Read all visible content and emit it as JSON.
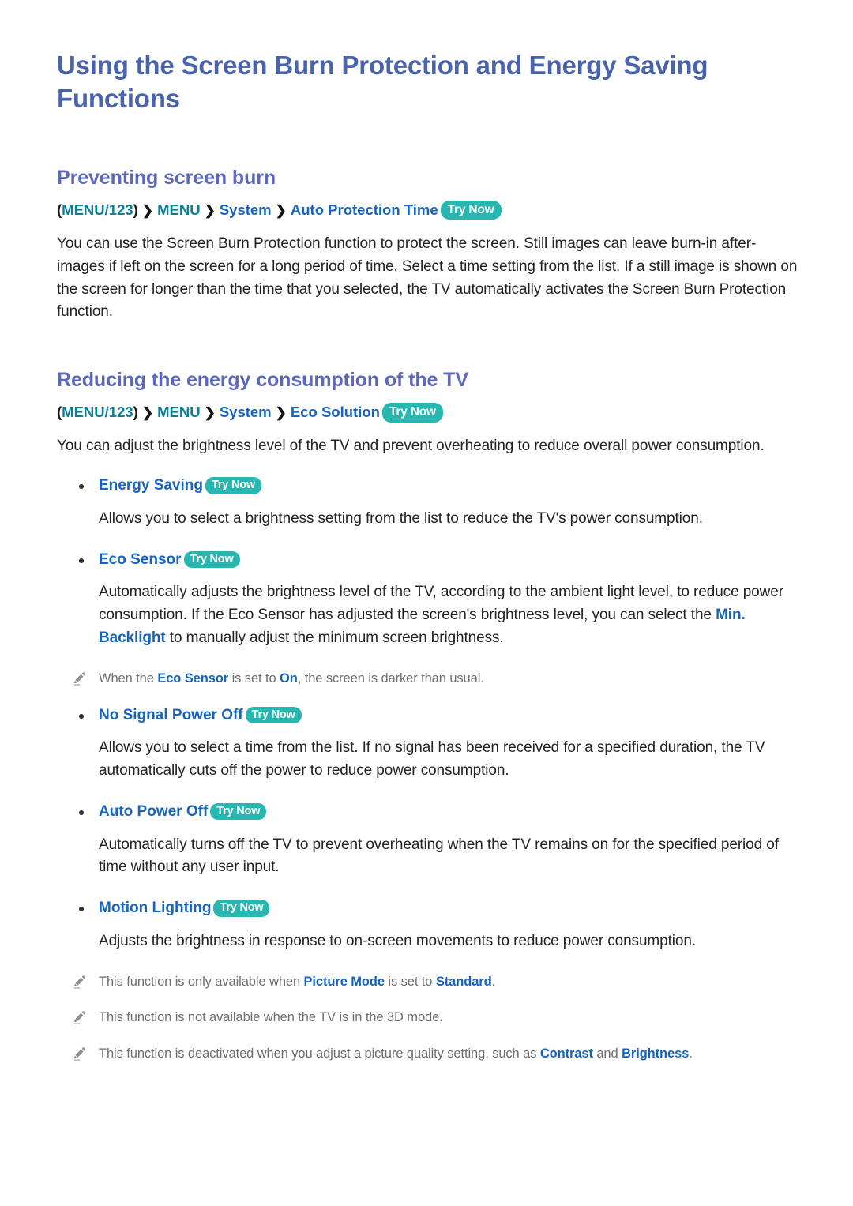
{
  "document": {
    "title": "Using the Screen Burn Protection and Energy Saving Functions"
  },
  "colors": {
    "title_blue": "#4a63ad",
    "heading_blue": "#5b68bc",
    "link_blue": "#1565c0",
    "breadcrumb_teal": "#0c7e96",
    "badge_teal": "#26b7b0",
    "body_text": "#232323",
    "note_text": "#6e6e6e"
  },
  "labels": {
    "try_now": "Try Now",
    "separator": "❯"
  },
  "sections": [
    {
      "heading": "Preventing screen burn",
      "breadcrumb": {
        "open_paren": "(",
        "root": "MENU/123",
        "close_paren": ")",
        "items": [
          "MENU",
          "System"
        ],
        "target": "Auto Protection Time",
        "badge": "Try Now"
      },
      "paragraph": "You can use the Screen Burn Protection function to protect the screen. Still images can leave burn-in after-images if left on the screen for a long period of time. Select a time setting from the list. If a still image is shown on the screen for longer than the time that you selected, the TV automatically activates the Screen Burn Protection function."
    },
    {
      "heading": "Reducing the energy consumption of the TV",
      "breadcrumb": {
        "open_paren": "(",
        "root": "MENU/123",
        "close_paren": ")",
        "items": [
          "MENU",
          "System"
        ],
        "target": "Eco Solution",
        "badge": "Try Now"
      },
      "paragraph": "You can adjust the brightness level of the TV and prevent overheating to reduce overall power consumption."
    }
  ],
  "bullets": [
    {
      "label": "Energy Saving",
      "badge": "Try Now",
      "body_parts": [
        {
          "text": "Allows you to select a brightness setting from the list to reduce the TV's power consumption.",
          "link": false
        }
      ]
    },
    {
      "label": "Eco Sensor",
      "badge": "Try Now",
      "body_parts": [
        {
          "text": "Automatically adjusts the brightness level of the TV, according to the ambient light level, to reduce power consumption. If the Eco Sensor has adjusted the screen's brightness level, you can select the ",
          "link": false
        },
        {
          "text": "Min. Backlight",
          "link": true
        },
        {
          "text": " to manually adjust the minimum screen brightness.",
          "link": false
        }
      ],
      "notes": [
        {
          "icon": "pencil-icon",
          "parts": [
            {
              "text": "When the ",
              "link": false
            },
            {
              "text": "Eco Sensor",
              "link": true
            },
            {
              "text": " is set to ",
              "link": false
            },
            {
              "text": "On",
              "link": true
            },
            {
              "text": ", the screen is darker than usual.",
              "link": false
            }
          ]
        }
      ]
    },
    {
      "label": "No Signal Power Off",
      "badge": "Try Now",
      "body_parts": [
        {
          "text": "Allows you to select a time from the list. If no signal has been received for a specified duration, the TV automatically cuts off the power to reduce power consumption.",
          "link": false
        }
      ]
    },
    {
      "label": "Auto Power Off",
      "badge": "Try Now",
      "body_parts": [
        {
          "text": "Automatically turns off the TV to prevent overheating when the TV remains on for the specified period of time without any user input.",
          "link": false
        }
      ]
    },
    {
      "label": "Motion Lighting",
      "badge": "Try Now",
      "body_parts": [
        {
          "text": "Adjusts the brightness in response to on-screen movements to reduce power consumption.",
          "link": false
        }
      ],
      "notes": [
        {
          "icon": "pencil-icon",
          "parts": [
            {
              "text": "This function is only available when ",
              "link": false
            },
            {
              "text": "Picture Mode",
              "link": true
            },
            {
              "text": " is set to ",
              "link": false
            },
            {
              "text": "Standard",
              "link": true
            },
            {
              "text": ".",
              "link": false
            }
          ]
        },
        {
          "icon": "pencil-icon",
          "parts": [
            {
              "text": "This function is not available when the TV is in the 3D mode.",
              "link": false
            }
          ]
        },
        {
          "icon": "pencil-icon",
          "parts": [
            {
              "text": "This function is deactivated when you adjust a picture quality setting, such as ",
              "link": false
            },
            {
              "text": "Contrast",
              "link": true
            },
            {
              "text": " and ",
              "link": false
            },
            {
              "text": "Brightness",
              "link": true
            },
            {
              "text": ".",
              "link": false
            }
          ]
        }
      ]
    }
  ]
}
